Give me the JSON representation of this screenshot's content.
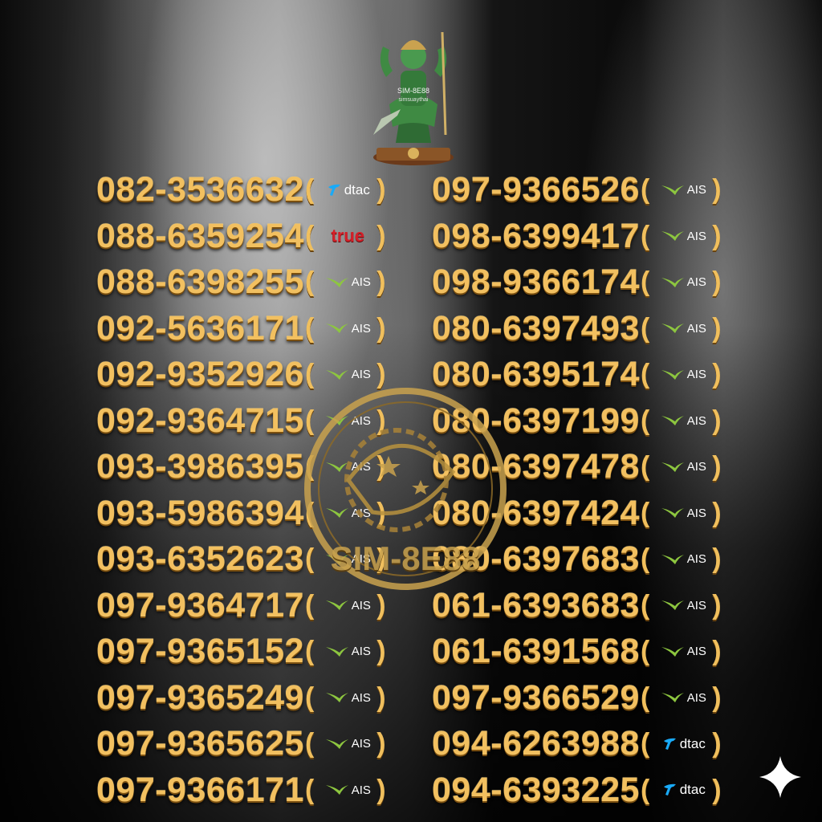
{
  "mascot": {
    "caption_line1": "SIM-8E88",
    "caption_line2": "simsuaythai"
  },
  "watermark": {
    "text": "SIM-8E88"
  },
  "numbers": {
    "left": [
      {
        "number": "082-3536632",
        "carrier": "dtac"
      },
      {
        "number": "088-6359254",
        "carrier": "true"
      },
      {
        "number": "088-6398255",
        "carrier": "AIS"
      },
      {
        "number": "092-5636171",
        "carrier": "AIS"
      },
      {
        "number": "092-9352926",
        "carrier": "AIS"
      },
      {
        "number": "092-9364715",
        "carrier": "AIS"
      },
      {
        "number": "093-3986395",
        "carrier": "AIS"
      },
      {
        "number": "093-5986394",
        "carrier": "AIS"
      },
      {
        "number": "093-6352623",
        "carrier": "AIS"
      },
      {
        "number": "097-9364717",
        "carrier": "AIS"
      },
      {
        "number": "097-9365152",
        "carrier": "AIS"
      },
      {
        "number": "097-9365249",
        "carrier": "AIS"
      },
      {
        "number": "097-9365625",
        "carrier": "AIS"
      },
      {
        "number": "097-9366171",
        "carrier": "AIS"
      }
    ],
    "right": [
      {
        "number": "097-9366526",
        "carrier": "AIS"
      },
      {
        "number": "098-6399417",
        "carrier": "AIS"
      },
      {
        "number": "098-9366174",
        "carrier": "AIS"
      },
      {
        "number": "080-6397493",
        "carrier": "AIS"
      },
      {
        "number": "080-6395174",
        "carrier": "AIS"
      },
      {
        "number": "080-6397199",
        "carrier": "AIS"
      },
      {
        "number": "080-6397478",
        "carrier": "AIS"
      },
      {
        "number": "080-6397424",
        "carrier": "AIS"
      },
      {
        "number": "080-6397683",
        "carrier": "AIS"
      },
      {
        "number": "061-6393683",
        "carrier": "AIS"
      },
      {
        "number": "061-6391568",
        "carrier": "AIS"
      },
      {
        "number": "097-9366529",
        "carrier": "AIS"
      },
      {
        "number": "094-6263988",
        "carrier": "dtac"
      },
      {
        "number": "094-6393225",
        "carrier": "dtac"
      }
    ]
  },
  "colors": {
    "gold": "#f2c060",
    "ais_green": "#8dc63f",
    "dtac_blue": "#19aaf8",
    "true_red": "#d41f28"
  },
  "icons": {
    "corner": "sparkle-icon"
  }
}
